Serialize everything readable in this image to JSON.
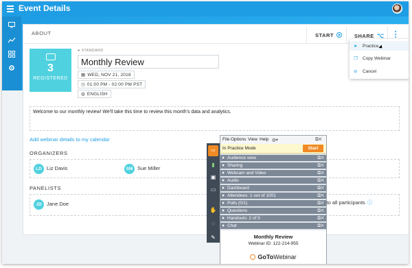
{
  "app": {
    "title": "Event Details"
  },
  "colors": {
    "primary": "#1f9de4",
    "registered_tile": "#4fd1df",
    "start_button": "#f08a24",
    "panel_row": "#7d8897"
  },
  "sidebar": {
    "items": [
      {
        "icon": "monitor-icon"
      },
      {
        "icon": "trend-chart-icon"
      },
      {
        "icon": "grid-icon"
      },
      {
        "icon": "gear-icon"
      }
    ]
  },
  "header": {
    "section": "ABOUT",
    "start_label": "START",
    "share_label": "SHARE"
  },
  "event": {
    "registered_count": "3",
    "registered_label": "REGISTERED",
    "type": "STANDARD",
    "title": "Monthly Review",
    "date": "WED, NOV 21, 2018",
    "time": "01:00 PM - 02:00 PM PST",
    "language": "ENGLISH",
    "description": "Welcome to our monthly review! We'll take this time to review this month's data and analytics."
  },
  "calendar_link": "Add webinar details to my calendar",
  "organizers": {
    "heading": "ORGANIZERS",
    "people": [
      {
        "initials": "LD",
        "name": "Liz Davis"
      },
      {
        "initials": "SM",
        "name": "Sue Miller"
      }
    ]
  },
  "panelists": {
    "heading": "PANELISTS",
    "people": [
      {
        "initials": "JD",
        "name": "Jane Doe"
      }
    ]
  },
  "email_all": "ate email to all participants",
  "share_menu": {
    "items": [
      {
        "label": "Practice",
        "icon": "paper-plane-icon"
      },
      {
        "label": "Copy Webinar",
        "icon": "copy-icon"
      },
      {
        "label": "Cancel",
        "icon": "cancel-icon"
      }
    ]
  },
  "gtw": {
    "menu": {
      "file": "File",
      "options": "Options",
      "view": "View",
      "help": "Help"
    },
    "practice_mode": "In Practice Mode",
    "start_button": "Start",
    "panes": [
      "Audience view",
      "Sharing",
      "Webcam and Video",
      "Audio",
      "Dashboard",
      "Attendees: 1 out of 1001",
      "Polls (0/1)",
      "Questions",
      "Handouts: 2 of 5",
      "Chat"
    ],
    "webinar_title": "Monthly Review",
    "webinar_id": "Webinar ID: 122-214-955",
    "logo_prefix": "GoTo",
    "logo_suffix": "Webinar"
  }
}
